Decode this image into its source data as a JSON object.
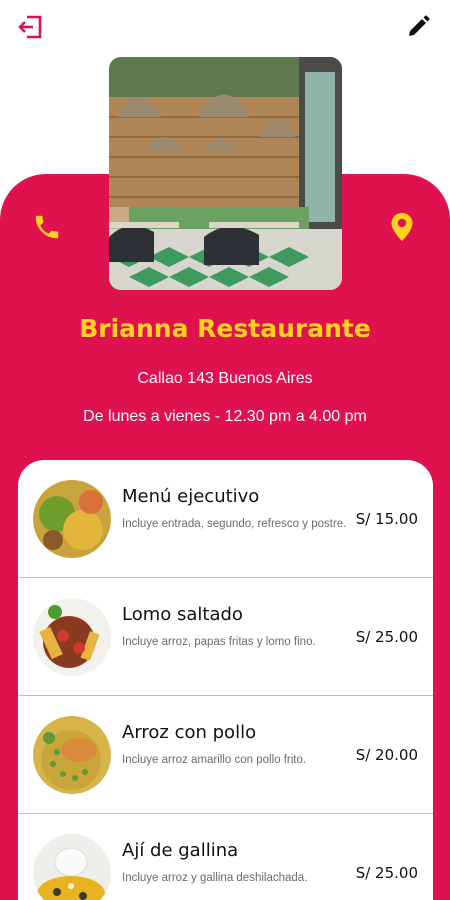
{
  "colors": {
    "accent": "#e0114f",
    "highlight": "#ffd21f",
    "text": "#111111",
    "muted": "#6b6b6b"
  },
  "header": {
    "exit_icon": "exit-icon",
    "edit_icon": "pencil-icon"
  },
  "restaurant": {
    "name": "Brianna Restaurante",
    "address": "Callao 143 Buenos Aires",
    "hours": "De lunes a vienes - 12.30 pm a 4.00 pm",
    "phone_icon": "phone-icon",
    "location_icon": "map-pin-icon"
  },
  "menu": [
    {
      "title": "Menú ejecutivo",
      "description": "Incluye entrada, segundo, refresco y postre.",
      "price": "S/ 15.00"
    },
    {
      "title": "Lomo saltado",
      "description": "Incluye arroz, papas fritas y lomo fino.",
      "price": "S/ 25.00"
    },
    {
      "title": "Arroz con pollo",
      "description": "Incluye arroz amarillo con pollo frito.",
      "price": "S/ 20.00"
    },
    {
      "title": "Ají de gallina",
      "description": "Incluye arroz y gallina deshilachada.",
      "price": "S/ 25.00"
    }
  ]
}
